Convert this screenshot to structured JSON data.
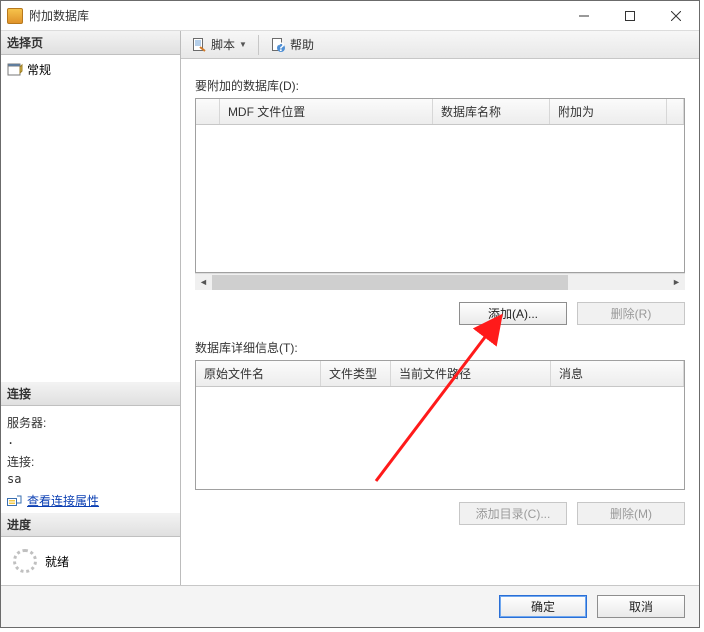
{
  "window": {
    "title": "附加数据库"
  },
  "left": {
    "selectPageHeader": "选择页",
    "navGeneral": "常规",
    "connectionHeader": "连接",
    "serverLabel": "服务器:",
    "serverValue": ".",
    "connLabel": "连接:",
    "connValue": "sa",
    "viewConnProps": "查看连接属性",
    "progressHeader": "进度",
    "ready": "就绪"
  },
  "toolbar": {
    "script": "脚本",
    "help": "帮助"
  },
  "main": {
    "dbsLabel": "要附加的数据库(D):",
    "dbsHeaders": {
      "mdf": "MDF 文件位置",
      "name": "数据库名称",
      "attachAs": "附加为"
    },
    "addBtn": "添加(A)...",
    "removeBtn": "删除(R)",
    "detailsLabel": "数据库详细信息(T):",
    "detailsHeaders": {
      "origName": "原始文件名",
      "type": "文件类型",
      "path": "当前文件路径",
      "msg": "消息"
    },
    "addDirBtn": "添加目录(C)...",
    "removeBtn2": "删除(M)"
  },
  "footer": {
    "ok": "确定",
    "cancel": "取消"
  }
}
